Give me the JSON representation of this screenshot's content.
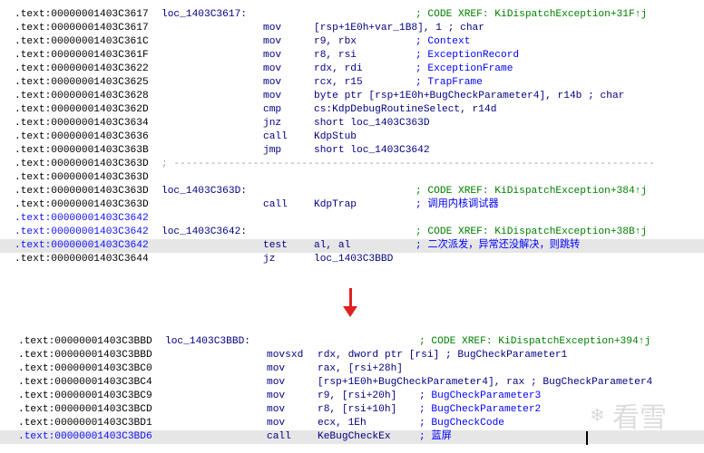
{
  "block1": {
    "lines": [
      {
        "addr": ".text:00000001403C3617",
        "label": "loc_1403C3617:",
        "mnemonic": "",
        "operands": "",
        "comment": "; CODE XREF: KiDispatchException+31F↑j",
        "xref": true
      },
      {
        "addr": ".text:00000001403C3617",
        "label": "",
        "mnemonic": "mov",
        "operands": "[rsp+1E0h+var_1B8], 1 ; char",
        "comment": ""
      },
      {
        "addr": ".text:00000001403C361C",
        "label": "",
        "mnemonic": "mov",
        "operands": "r9, rbx",
        "comment": "; Context"
      },
      {
        "addr": ".text:00000001403C361F",
        "label": "",
        "mnemonic": "mov",
        "operands": "r8, rsi",
        "comment": "; ExceptionRecord"
      },
      {
        "addr": ".text:00000001403C3622",
        "label": "",
        "mnemonic": "mov",
        "operands": "rdx, rdi",
        "comment": "; ExceptionFrame"
      },
      {
        "addr": ".text:00000001403C3625",
        "label": "",
        "mnemonic": "mov",
        "operands": "rcx, r15",
        "comment": "; TrapFrame"
      },
      {
        "addr": ".text:00000001403C3628",
        "label": "",
        "mnemonic": "mov",
        "operands": "byte ptr [rsp+1E0h+BugCheckParameter4], r14b ; char",
        "comment": ""
      },
      {
        "addr": ".text:00000001403C362D",
        "label": "",
        "mnemonic": "cmp",
        "operands": "cs:KdpDebugRoutineSelect, r14d",
        "comment": ""
      },
      {
        "addr": ".text:00000001403C3634",
        "label": "",
        "mnemonic": "jnz",
        "operands": "short loc_1403C363D",
        "comment": ""
      },
      {
        "addr": ".text:00000001403C3636",
        "label": "",
        "mnemonic": "call",
        "operands": "KdpStub",
        "comment": ""
      },
      {
        "addr": ".text:00000001403C363B",
        "label": "",
        "mnemonic": "jmp",
        "operands": "short loc_1403C3642",
        "comment": ""
      },
      {
        "addr": ".text:00000001403C363D",
        "label": "; -------------------------------------------------------------------------------",
        "mnemonic": "",
        "operands": "",
        "comment": "",
        "separator": true
      },
      {
        "addr": ".text:00000001403C363D",
        "label": "",
        "mnemonic": "",
        "operands": "",
        "comment": ""
      },
      {
        "addr": ".text:00000001403C363D",
        "label": "loc_1403C363D:",
        "mnemonic": "",
        "operands": "",
        "comment": "; CODE XREF: KiDispatchException+384↑j",
        "xref": true
      },
      {
        "addr": ".text:00000001403C363D",
        "label": "",
        "mnemonic": "call",
        "operands": "KdpTrap",
        "comment": "; 调用内核调试器"
      },
      {
        "addr": ".text:00000001403C3642",
        "label": "",
        "mnemonic": "",
        "operands": "",
        "comment": "",
        "blue": true
      },
      {
        "addr": ".text:00000001403C3642",
        "label": "loc_1403C3642:",
        "mnemonic": "",
        "operands": "",
        "comment": "; CODE XREF: KiDispatchException+38B↑j",
        "xref": true,
        "blue": true
      },
      {
        "addr": ".text:00000001403C3642",
        "label": "",
        "mnemonic": "test",
        "operands": "al, al",
        "comment": "; 二次派发，异常还没解决，则跳转",
        "blue": true,
        "highlight": true
      },
      {
        "addr": ".text:00000001403C3644",
        "label": "",
        "mnemonic": "jz",
        "operands": "loc_1403C3BBD",
        "comment": ""
      }
    ]
  },
  "block2": {
    "lines": [
      {
        "addr": ".text:00000001403C3BBD",
        "label": "loc_1403C3BBD:",
        "mnemonic": "",
        "operands": "",
        "comment": "; CODE XREF: KiDispatchException+394↑j",
        "xref": true
      },
      {
        "addr": ".text:00000001403C3BBD",
        "label": "",
        "mnemonic": "movsxd",
        "operands": "rdx, dword ptr [rsi] ; BugCheckParameter1",
        "comment": ""
      },
      {
        "addr": ".text:00000001403C3BC0",
        "label": "",
        "mnemonic": "mov",
        "operands": "rax, [rsi+28h]",
        "comment": ""
      },
      {
        "addr": ".text:00000001403C3BC4",
        "label": "",
        "mnemonic": "mov",
        "operands": "[rsp+1E0h+BugCheckParameter4], rax ; BugCheckParameter4",
        "comment": ""
      },
      {
        "addr": ".text:00000001403C3BC9",
        "label": "",
        "mnemonic": "mov",
        "operands": "r9, [rsi+20h]",
        "comment": "; BugCheckParameter3",
        "commentOffset": true
      },
      {
        "addr": ".text:00000001403C3BCD",
        "label": "",
        "mnemonic": "mov",
        "operands": "r8, [rsi+10h]",
        "comment": "; BugCheckParameter2",
        "commentOffset": true
      },
      {
        "addr": ".text:00000001403C3BD1",
        "label": "",
        "mnemonic": "mov",
        "operands": "ecx, 1Eh",
        "comment": "; BugCheckCode",
        "commentOffset": true
      },
      {
        "addr": ".text:00000001403C3BD6",
        "label": "",
        "mnemonic": "call",
        "operands": "KeBugCheckEx",
        "comment": "; 蓝屏",
        "blue": true,
        "highlight": true,
        "commentOffset": true
      }
    ]
  },
  "watermark": {
    "text": "看雪",
    "icon": "snowflake-icon"
  },
  "arrow": {
    "icon": "down-arrow-icon",
    "color": "#e02020"
  }
}
